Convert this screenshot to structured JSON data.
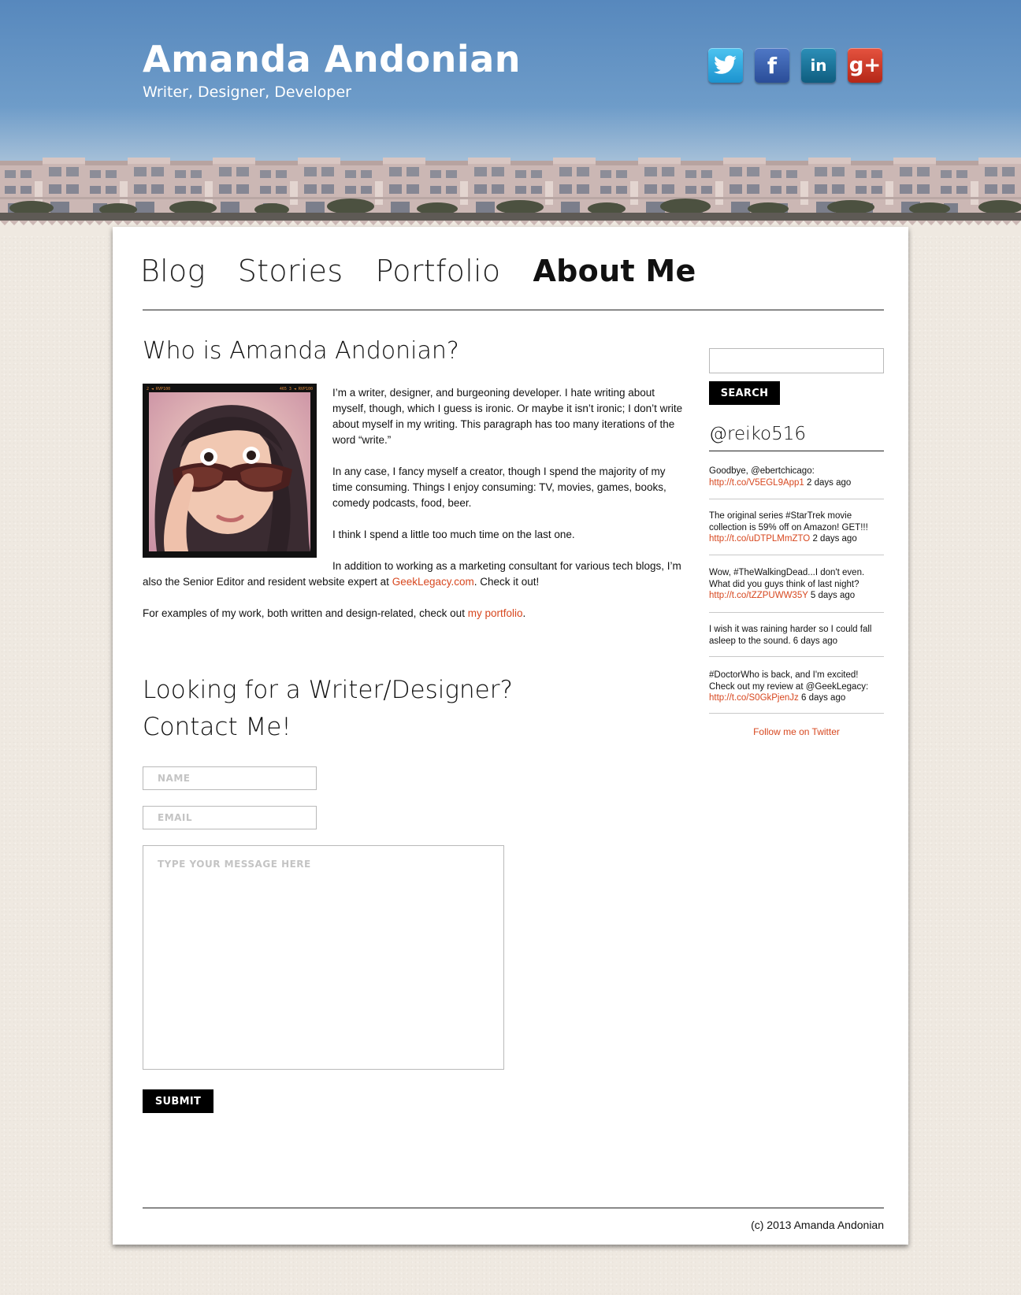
{
  "header": {
    "title": "Amanda Andonian",
    "tagline": "Writer, Designer, Developer"
  },
  "social": [
    {
      "name": "twitter",
      "icon": "twitter-bird-icon",
      "glyph": ""
    },
    {
      "name": "facebook",
      "icon": "facebook-icon",
      "glyph": "f"
    },
    {
      "name": "linkedin",
      "icon": "linkedin-icon",
      "glyph": "in"
    },
    {
      "name": "googleplus",
      "icon": "google-plus-icon",
      "glyph": "g+"
    }
  ],
  "nav": {
    "items": [
      {
        "label": "Blog"
      },
      {
        "label": "Stories"
      },
      {
        "label": "Portfolio"
      },
      {
        "label": "About Me",
        "active": true
      }
    ]
  },
  "about": {
    "heading": "Who is Amanda Andonian?",
    "photo_film_text_left": "2 ◄  RVP100",
    "photo_film_text_right": "465   3 ◄  RVP100",
    "p1": "I’m a writer, designer, and burgeoning developer. I hate writing about myself, though, which I guess is ironic. Or maybe it isn’t ironic; I don’t write about myself in my writing. This paragraph has too many iterations of the word “write.”",
    "p2": "In any case, I fancy myself a creator, though I spend the majority of my time consuming. Things I enjoy consuming: TV, movies, games, books, comedy podcasts, food, beer.",
    "p3": "I think I spend a little too much time on the last one.",
    "p4_before": "In addition to working as a marketing consultant for various tech blogs, I’m also the Senior Editor and resident website expert at ",
    "p4_link": "GeekLegacy.com",
    "p4_after": ". Check it out!",
    "p5_before": "For examples of my work, both written and design-related, check out ",
    "p5_link": "my portfolio",
    "p5_after": "."
  },
  "contact": {
    "heading_line1": "Looking for a Writer/Designer?",
    "heading_line2": "Contact Me!",
    "name_placeholder": "NAME",
    "email_placeholder": "EMAIL",
    "message_placeholder": "TYPE YOUR MESSAGE HERE",
    "submit_label": "SUBMIT"
  },
  "sidebar": {
    "search_value": "",
    "search_label": "SEARCH",
    "twitter_handle": "@reiko516",
    "tweets": [
      {
        "text": "Goodbye, @ebertchicago:",
        "link": "http://t.co/V5EGL9App1",
        "time": "2 days ago"
      },
      {
        "text": "The original series #StarTrek movie collection is 59% off on Amazon! GET!!!",
        "link": "http://t.co/uDTPLMmZTO",
        "time": "2 days ago"
      },
      {
        "text": "Wow, #TheWalkingDead...I don't even. What did you guys think of last night?",
        "link": "http://t.co/tZZPUWW35Y",
        "time": "5 days ago"
      },
      {
        "text": "I wish it was raining harder so I could fall asleep to the sound.",
        "link": "",
        "time": "6 days ago"
      },
      {
        "text": "#DoctorWho is back, and I'm excited! Check out my review at @GeekLegacy:",
        "link": "http://t.co/S0GkPjenJz",
        "time": "6 days ago"
      }
    ],
    "follow_label": "Follow me on Twitter"
  },
  "footer": {
    "copyright": "(c) 2013 Amanda Andonian"
  },
  "colors": {
    "accent_link": "#d7471f",
    "sky_top": "#5788bd",
    "page_bg": "#efe9e1"
  }
}
